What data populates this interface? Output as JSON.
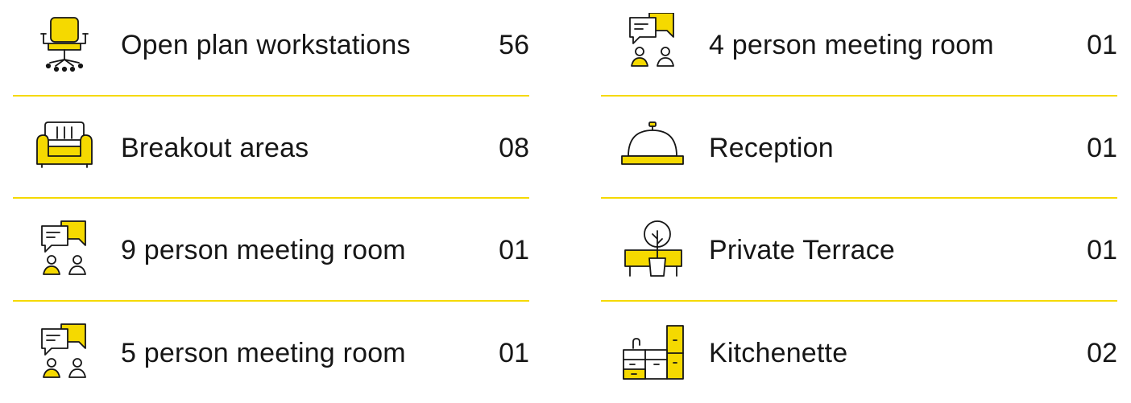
{
  "accent_color": "#f5d900",
  "left_column": [
    {
      "icon": "office-chair-icon",
      "label": "Open plan workstations",
      "count": "56"
    },
    {
      "icon": "armchair-icon",
      "label": "Breakout areas",
      "count": "08"
    },
    {
      "icon": "meeting-chat-icon",
      "label": "9 person meeting room",
      "count": "01"
    },
    {
      "icon": "meeting-chat-icon",
      "label": "5 person meeting room",
      "count": "01"
    }
  ],
  "right_column": [
    {
      "icon": "meeting-chat-icon",
      "label": "4 person meeting room",
      "count": "01"
    },
    {
      "icon": "reception-bell-icon",
      "label": "Reception",
      "count": "01"
    },
    {
      "icon": "terrace-tree-icon",
      "label": "Private Terrace",
      "count": "01"
    },
    {
      "icon": "kitchen-cabinets-icon",
      "label": "Kitchenette",
      "count": "02"
    }
  ]
}
